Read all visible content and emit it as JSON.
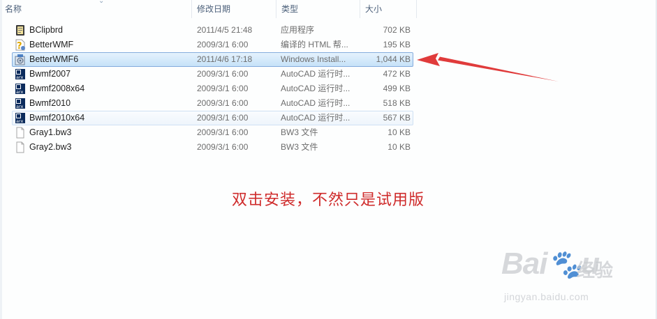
{
  "columns": {
    "name": "名称",
    "date": "修改日期",
    "type": "类型",
    "size": "大小"
  },
  "files": [
    {
      "name": "BClipbrd",
      "date": "2011/4/5 21:48",
      "type": "应用程序",
      "size": "702 KB",
      "icon": "application-icon"
    },
    {
      "name": "BetterWMF",
      "date": "2009/3/1 6:00",
      "type": "编译的 HTML 帮...",
      "size": "195 KB",
      "icon": "help-file-icon"
    },
    {
      "name": "BetterWMF6",
      "date": "2011/4/6 17:18",
      "type": "Windows Install...",
      "size": "1,044 KB",
      "icon": "installer-icon"
    },
    {
      "name": "Bwmf2007",
      "date": "2009/3/1 6:00",
      "type": "AutoCAD 运行时...",
      "size": "472 KB",
      "icon": "arx-icon"
    },
    {
      "name": "Bwmf2008x64",
      "date": "2009/3/1 6:00",
      "type": "AutoCAD 运行时...",
      "size": "499 KB",
      "icon": "arx-icon"
    },
    {
      "name": "Bwmf2010",
      "date": "2009/3/1 6:00",
      "type": "AutoCAD 运行时...",
      "size": "518 KB",
      "icon": "arx-icon"
    },
    {
      "name": "Bwmf2010x64",
      "date": "2009/3/1 6:00",
      "type": "AutoCAD 运行时...",
      "size": "567 KB",
      "icon": "arx-icon"
    },
    {
      "name": "Gray1.bw3",
      "date": "2009/3/1 6:00",
      "type": "BW3 文件",
      "size": "10 KB",
      "icon": "blank-file-icon"
    },
    {
      "name": "Gray2.bw3",
      "date": "2009/3/1 6:00",
      "type": "BW3 文件",
      "size": "10 KB",
      "icon": "blank-file-icon"
    }
  ],
  "selected_file": "BetterWMF6",
  "annotation": "双击安装，不然只是试用版",
  "annotation_color": "#cf2b2b",
  "selection_color": "#c6e2f8",
  "watermark": {
    "logo": "Baidu经验",
    "url": "jingyan.baidu.com"
  }
}
